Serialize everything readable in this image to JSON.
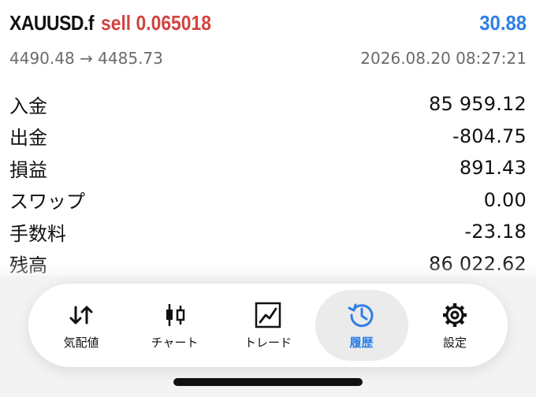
{
  "trade": {
    "symbol": "XAUUSD.f",
    "side": "sell 0.065018",
    "profit": "30.88",
    "price_range": "4490.48 → 4485.73",
    "timestamp": "2026.08.20 08:27:21"
  },
  "summary": [
    {
      "label": "入金",
      "value": "85 959.12"
    },
    {
      "label": "出金",
      "value": "-804.75"
    },
    {
      "label": "損益",
      "value": "891.43"
    },
    {
      "label": "スワップ",
      "value": "0.00"
    },
    {
      "label": "手数料",
      "value": "-23.18"
    },
    {
      "label": "残高",
      "value": "86 022.62"
    }
  ],
  "tabbar": {
    "tabs": [
      {
        "label": "気配値",
        "icon": "quotes-icon"
      },
      {
        "label": "チャート",
        "icon": "candlestick-icon"
      },
      {
        "label": "トレード",
        "icon": "trade-chart-icon"
      },
      {
        "label": "履歴",
        "icon": "history-icon",
        "active": true
      },
      {
        "label": "設定",
        "icon": "gear-icon"
      }
    ]
  },
  "colors": {
    "sell": "#d2433f",
    "profit": "#2f7fe6",
    "active_tab": "#2f7fe6"
  }
}
